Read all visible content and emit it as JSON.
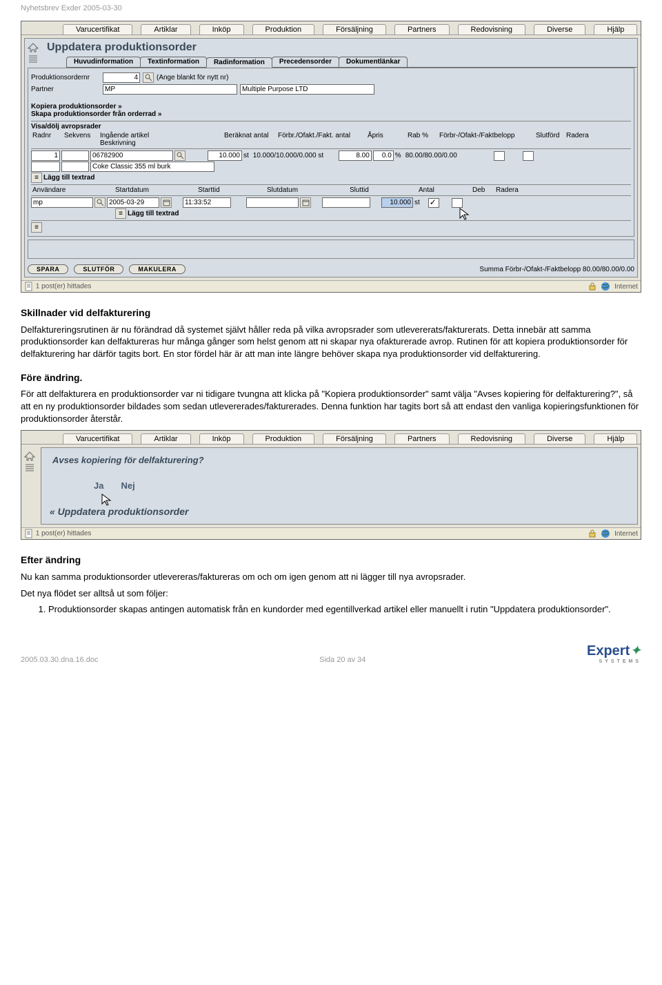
{
  "doc_header": "Nyhetsbrev Exder 2005-03-30",
  "menu": [
    "Varucertifikat",
    "Artiklar",
    "Inköp",
    "Produktion",
    "Försäljning",
    "Partners",
    "Redovisning",
    "Diverse",
    "Hjälp"
  ],
  "shot1": {
    "title": "Uppdatera produktionsorder",
    "subtabs": [
      "Huvudinformation",
      "Textinformation",
      "Radinformation",
      "Precedensorder",
      "Dokumentlänkar"
    ],
    "active_subtab": 2,
    "order_nr_label": "Produktionsordernr",
    "order_nr_value": "4",
    "order_nr_hint": "(Ange blankt för nytt nr)",
    "partner_label": "Partner",
    "partner_code": "MP",
    "partner_name": "Multiple Purpose LTD",
    "link1": "Kopiera produktionsorder »",
    "link2": "Skapa produktionsorder från orderrad »",
    "section_visa": "Visa/dölj avropsrader",
    "cols_a": [
      "Radnr",
      "Sekvens",
      "Ingående artikel",
      "Beskrivning",
      "Beräknat antal",
      "Förbr./Ofakt./Fakt. antal",
      "Åpris",
      "Rab %",
      "Förbr-/Ofakt-/Faktbelopp",
      "Slutförd",
      "Radera"
    ],
    "row1": {
      "radnr": "1",
      "sekvens": "",
      "artikel": "06782900",
      "antal": "10.000",
      "unit": "st",
      "forbr_antal": "10.000/10.000/0.000 st",
      "apris": "8.00",
      "rab": "0.0",
      "rab_unit": "%",
      "belopp": "80.00/80.00/0.00"
    },
    "row2_desc": "Coke Classic 355 ml burk",
    "lagg_till": "Lägg till textrad",
    "cols_b": [
      "Användare",
      "Startdatum",
      "Starttid",
      "Slutdatum",
      "Sluttid",
      "Antal",
      "Deb",
      "Radera"
    ],
    "rowb": {
      "user": "mp",
      "startdatum": "2005-03-29",
      "starttid": "11:33:52",
      "slutdatum": "",
      "sluttid": "",
      "antal": "10.000",
      "antal_unit": "st"
    },
    "btns": [
      "SPARA",
      "SLUTFÖR",
      "MAKULERA"
    ],
    "summa_label": "Summa Förbr-/Ofakt-/Faktbelopp",
    "summa_val": "80.00/80.00/0.00",
    "status_left": "1 post(er) hittades",
    "status_right": "Internet"
  },
  "para1_title": "Skillnader vid delfakturering",
  "para1": "Delfaktureringsrutinen är nu förändrad då systemet självt håller reda på vilka avropsrader som utlevererats/fakturerats. Detta innebär att samma produktionsorder kan delfaktureras hur många gånger som helst genom att ni skapar nya ofakturerade avrop. Rutinen för att kopiera produktionsorder för delfakturering har därför tagits bort. En stor fördel här är att man inte längre behöver skapa nya produktionsorder vid delfakturering.",
  "para2_title": "Före ändring.",
  "para2": "För att delfakturera en produktionsorder var ni tidigare tvungna att klicka på \"Kopiera produktionsorder\" samt välja \"Avses kopiering för delfakturering?\", så att en ny produktionsorder bildades som sedan utlevererades/fakturerades. Denna funktion har tagits bort så att endast den vanliga kopieringsfunktionen för produktionsorder återstår.",
  "shot2": {
    "question": "Avses kopiering för delfakturering?",
    "ja": "Ja",
    "nej": "Nej",
    "back": "« Uppdatera produktionsorder",
    "status_left": "1 post(er) hittades",
    "status_right": "Internet"
  },
  "para3_title": "Efter ändring",
  "para3a": "Nu kan samma produktionsorder utlevereras/faktureras om och om igen genom att ni lägger till nya avropsrader.",
  "para3b": "Det nya flödet ser alltså ut som följer:",
  "para3_li": "Produktionsorder skapas antingen automatisk från en kundorder med egentillverkad artikel eller manuellt i rutin \"Uppdatera produktionsorder\".",
  "footer_left": "2005.03.30.dna.16.doc",
  "footer_mid": "Sida 20 av 34",
  "logo_main": "Expert",
  "logo_sub": "SYSTEMS"
}
